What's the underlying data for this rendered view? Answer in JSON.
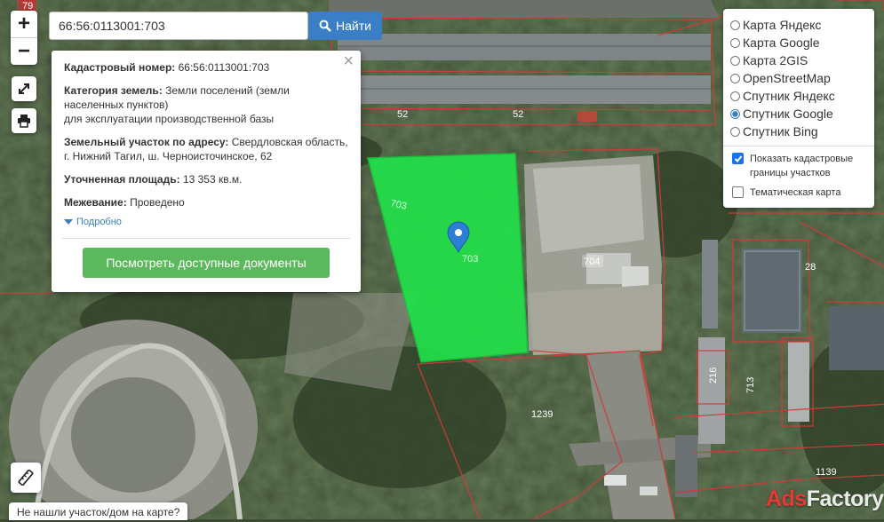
{
  "search": {
    "value": "66:56:0113001:703",
    "button_label": "Найти"
  },
  "zoom": {
    "plus": "+",
    "minus": "−"
  },
  "popup": {
    "cadastral_label": "Кадастровый номер:",
    "cadastral_value": "66:56:0113001:703",
    "category_label": "Категория земель:",
    "category_value": "Земли поселений (земли населенных пунктов)",
    "category_use": "для эксплуатации производственной базы",
    "address_label": "Земельный участок по адресу:",
    "address_value": "Свердловская область, г. Нижний Тагил, ш. Черноисточинское, 62",
    "area_label": "Уточненная площадь:",
    "area_value": "13 353 кв.м.",
    "survey_label": "Межевание:",
    "survey_value": "Проведено",
    "more_link": "Подробно",
    "docs_button": "Посмотреть доступные документы",
    "close": "×"
  },
  "layers": {
    "options": [
      {
        "label": "Карта Яндекс",
        "selected": false
      },
      {
        "label": "Карта Google",
        "selected": false
      },
      {
        "label": "Карта 2GIS",
        "selected": false
      },
      {
        "label": "OpenStreetMap",
        "selected": false
      },
      {
        "label": "Спутник Яндекс",
        "selected": false
      },
      {
        "label": "Спутник Google",
        "selected": true
      },
      {
        "label": "Спутник Bing",
        "selected": false
      }
    ],
    "show_borders": {
      "label": "Показать кадастровые границы участков",
      "checked": true
    },
    "thematic": {
      "label": "Тематическая карта",
      "checked": false
    }
  },
  "map_labels": {
    "l79": "79",
    "l52a": "52",
    "l52b": "52",
    "l703a": "703",
    "l703b": "703",
    "l704": "704",
    "l28": "28",
    "l216": "216",
    "l713": "713",
    "l1239a": "1239",
    "l1139": "1139"
  },
  "not_found": "Не нашли участок/дом на карте?",
  "watermark": {
    "a": "Ads",
    "b": "Factory"
  },
  "colors": {
    "parcel": "#22e04a",
    "accent": "#3a7fc6",
    "docs_button": "#5cb85c",
    "cadastral_lines": "#d23a3a"
  }
}
